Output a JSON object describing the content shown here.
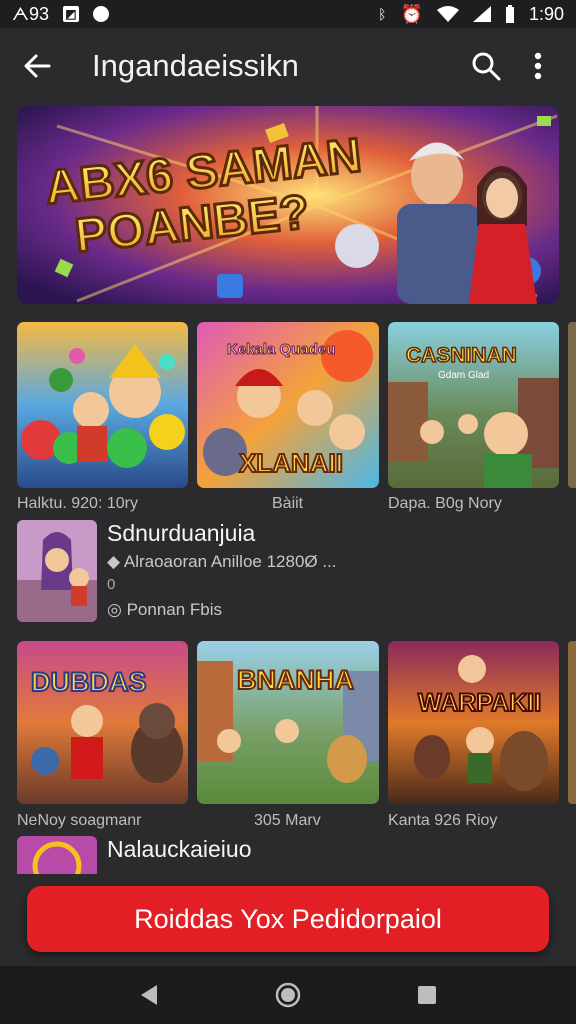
{
  "status_bar": {
    "left_text": "ᗅ93",
    "time": "1:90",
    "icons": [
      "photo-icon",
      "sync-icon",
      "nfc-icon",
      "alarm-icon",
      "wifi-icon",
      "signal-icon",
      "battery-icon"
    ]
  },
  "app_bar": {
    "title": "Ingandaeissikn",
    "icons": [
      "back-arrow-icon",
      "search-icon",
      "more-vert-icon"
    ]
  },
  "banner": {
    "title_line1": "ABX6 SAMAN",
    "title_line2": "POANBE?"
  },
  "row1": [
    {
      "art_text": "",
      "caption": "Halktu. 920: 10ry"
    },
    {
      "art_text": "XLANAII",
      "art_small": "Kekala Quadeu",
      "caption": "Bàiit"
    },
    {
      "art_text": "CASNINAN",
      "art_small": "Gdam Glad",
      "caption": "Dapa. B0g Nory"
    }
  ],
  "featured": {
    "title": "Sdnurduanjuia",
    "subtitle": "Alraoaoran  Anilloe  1280Ø ...",
    "small_num": "0",
    "developer": "Ponnan Fbis"
  },
  "row2": [
    {
      "art_text": "DUBDAS",
      "caption": "NeNoy soagmanr"
    },
    {
      "art_text": "BNANHA",
      "caption": "305 Marv"
    },
    {
      "art_text": "WARPAKII",
      "caption": "Kanta  926  Rioy"
    }
  ],
  "row3_title": "Nalauckaieiuo",
  "cta_label": "Roiddas Yox Pedidorpaiol",
  "colors": {
    "accent": "#e11f25",
    "background": "#2b2b2d",
    "bar": "#1e1e20"
  }
}
